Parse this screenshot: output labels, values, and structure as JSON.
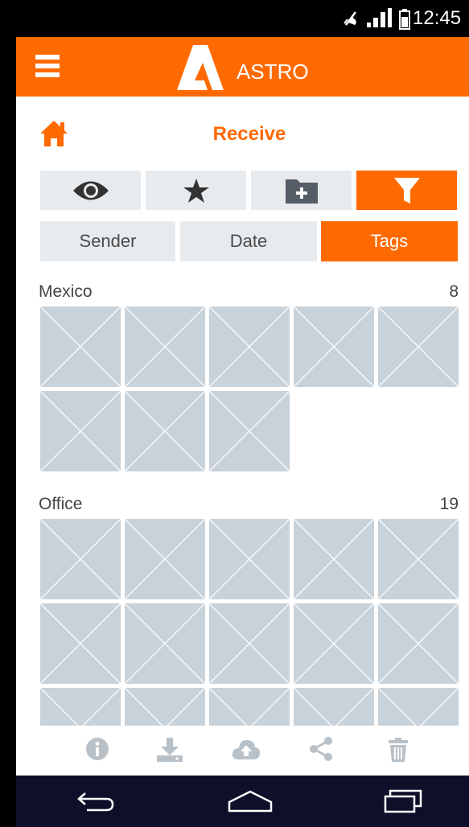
{
  "status_bar": {
    "time": "12:45"
  },
  "app_bar": {
    "title": "ASTRO"
  },
  "header": {
    "title": "Receive"
  },
  "sort_tabs": [
    {
      "label": "Sender",
      "active": false
    },
    {
      "label": "Date",
      "active": false
    },
    {
      "label": "Tags",
      "active": true
    }
  ],
  "groups": [
    {
      "name": "Mexico",
      "count": "8"
    },
    {
      "name": "Office",
      "count": "19"
    }
  ],
  "view_buttons": [
    "eye-icon",
    "star-icon",
    "new-folder-icon",
    "filter-icon"
  ],
  "toolbar_icons": [
    "info-icon",
    "download-icon",
    "upload-cloud-icon",
    "share-icon",
    "trash-icon"
  ],
  "colors": {
    "accent": "#ff6a00",
    "tab_bg": "#e8ebee",
    "thumb": "#c8d2da",
    "nav": "#0e0f29"
  }
}
